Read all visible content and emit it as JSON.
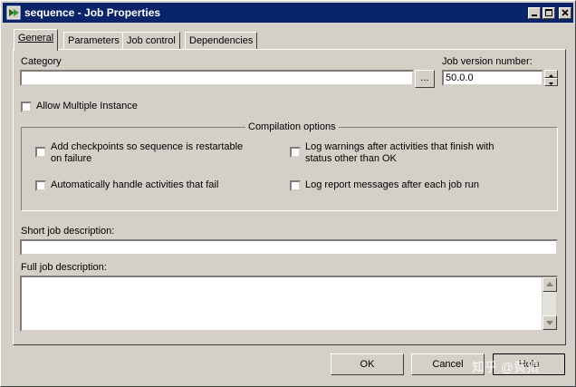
{
  "window": {
    "title": "sequence - Job Properties"
  },
  "tabs": [
    {
      "label": "General"
    },
    {
      "label": "Parameters"
    },
    {
      "label": "Job control"
    },
    {
      "label": "Dependencies"
    }
  ],
  "general": {
    "category_label": "Category",
    "category_value": "",
    "browse_label": "...",
    "version_label": "Job version number:",
    "version_value": "50.0.0",
    "allow_multiple_label": "Allow Multiple Instance",
    "allow_multiple_checked": false
  },
  "compilation": {
    "title": "Compilation options",
    "options": [
      {
        "label_lines": [
          "Add checkpoints so sequence is restartable",
          "on failure"
        ],
        "checked": false
      },
      {
        "label_lines": [
          "Log warnings after activities that finish with",
          "status other than OK"
        ],
        "checked": false
      },
      {
        "label_lines": [
          "Automatically handle activities that fail"
        ],
        "checked": false
      },
      {
        "label_lines": [
          "Log report messages after each job run"
        ],
        "checked": false
      }
    ]
  },
  "descriptions": {
    "short_label": "Short job description:",
    "short_value": "",
    "full_label": "Full job description:",
    "full_value": ""
  },
  "buttons": {
    "ok": "OK",
    "cancel": "Cancel",
    "help": "Help"
  },
  "watermark": "知乎 @黄猿"
}
